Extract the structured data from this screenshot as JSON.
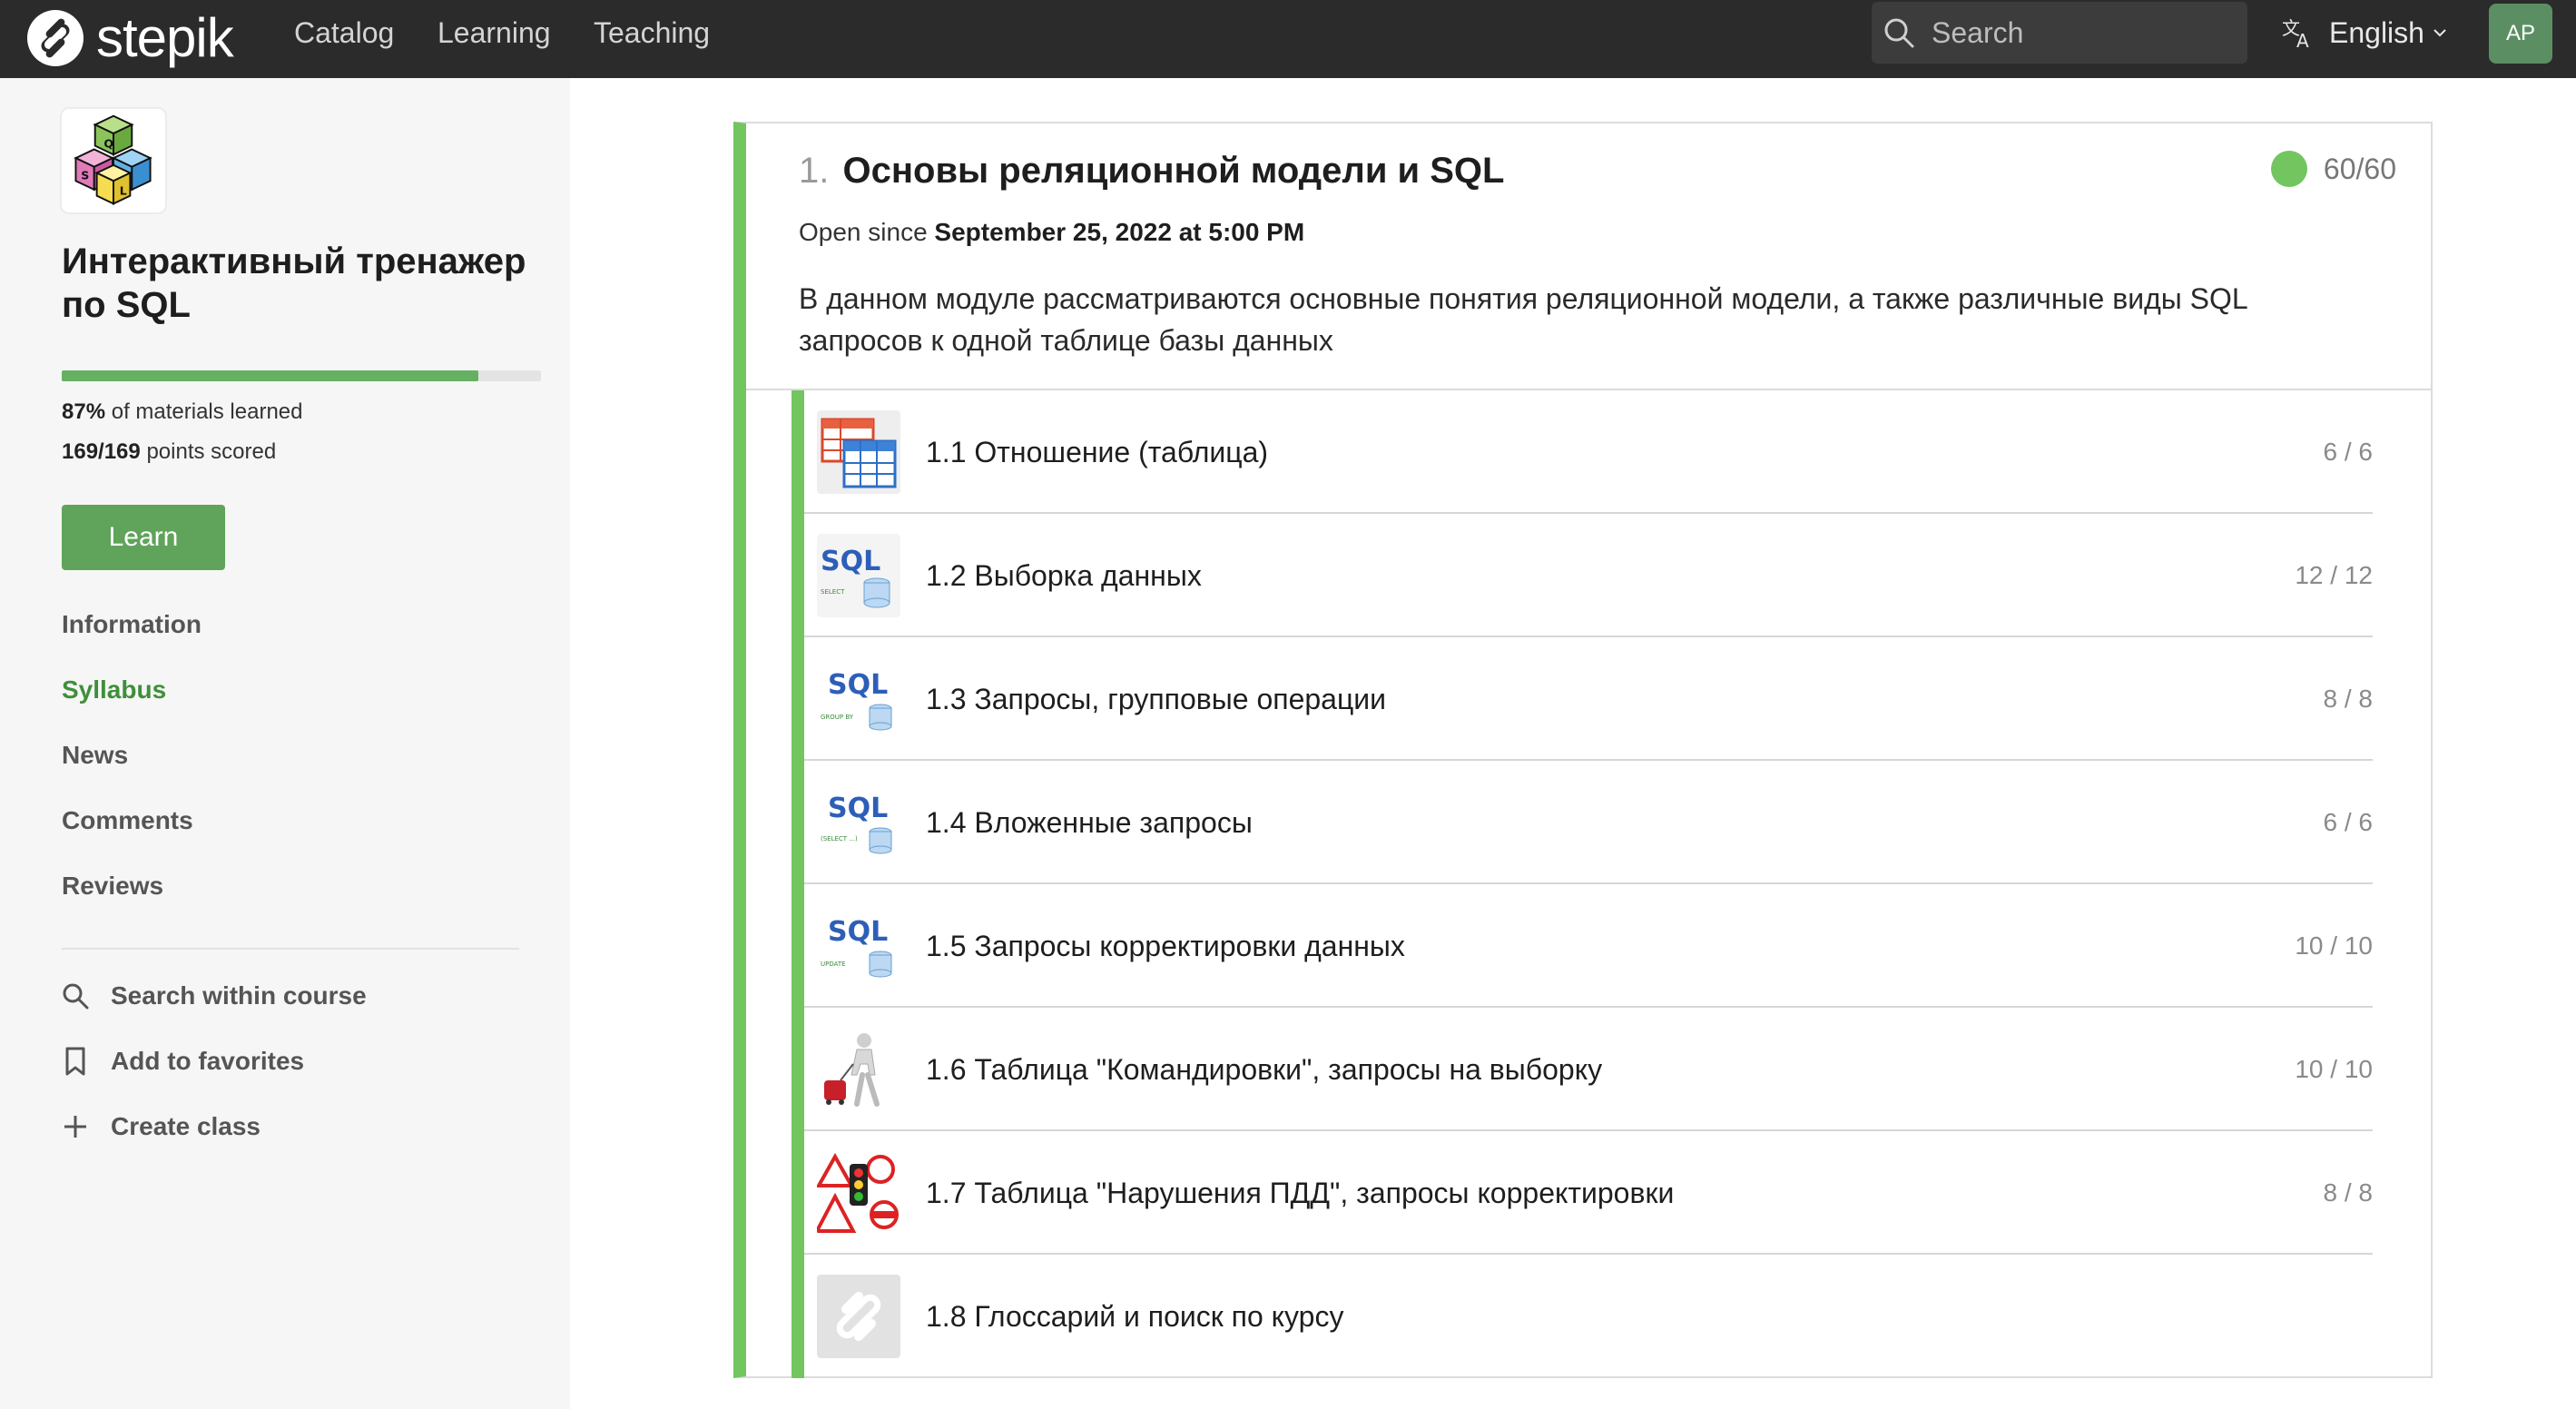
{
  "header": {
    "brand": "stepik",
    "nav": [
      "Catalog",
      "Learning",
      "Teaching"
    ],
    "search_placeholder": "Search",
    "language": "English",
    "avatar_initials": "AP"
  },
  "sidebar": {
    "course_title": "Интерактивный тренажер по SQL",
    "progress_fraction": 0.87,
    "materials_percent": "87%",
    "materials_label": "of materials learned",
    "points": "169/169",
    "points_label": "points scored",
    "learn_button": "Learn",
    "links": [
      "Information",
      "Syllabus",
      "News",
      "Comments",
      "Reviews"
    ],
    "active_link": "Syllabus",
    "actions": {
      "search": "Search within course",
      "favorites": "Add to favorites",
      "create_class": "Create class"
    }
  },
  "module": {
    "number": "1.",
    "title": "Основы реляционной модели и SQL",
    "score": "60/60",
    "open_since_label": "Open since",
    "open_since_date": "September 25, 2022 at 5:00 PM",
    "description": "В данном модуле рассматриваются основные понятия реляционной модели, а также различные виды SQL запросов к одной таблице базы данных",
    "accent_color": "#72c55f",
    "lessons": [
      {
        "title": "1.1 Отношение (таблица)",
        "score": "6 / 6",
        "icon": "table-icon"
      },
      {
        "title": "1.2 Выборка данных",
        "score": "12 / 12",
        "icon": "sql-select-icon"
      },
      {
        "title": "1.3 Запросы, групповые операции",
        "score": "8 / 8",
        "icon": "sql-group-by-icon"
      },
      {
        "title": "1.4 Вложенные запросы",
        "score": "6 / 6",
        "icon": "sql-subquery-icon"
      },
      {
        "title": "1.5 Запросы корректировки данных",
        "score": "10 / 10",
        "icon": "sql-update-icon"
      },
      {
        "title": "1.6 Таблица \"Командировки\", запросы на выборку",
        "score": "10 / 10",
        "icon": "traveler-icon"
      },
      {
        "title": "1.7 Таблица \"Нарушения ПДД\", запросы корректировки",
        "score": "8 / 8",
        "icon": "traffic-signs-icon"
      },
      {
        "title": "1.8 Глоссарий и поиск по курсу",
        "score": "",
        "icon": "stepik-placeholder-icon"
      }
    ]
  }
}
